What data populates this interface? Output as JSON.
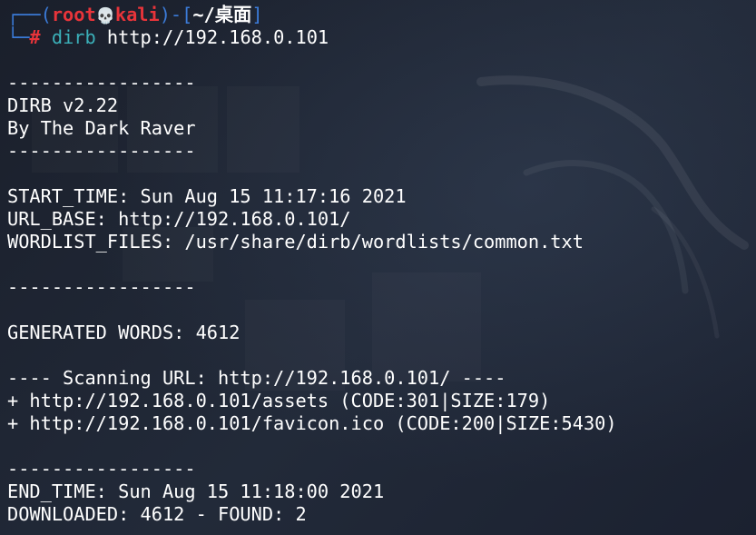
{
  "prompt": {
    "frame_top": "┌──(",
    "user": "root",
    "skull": "💀",
    "host": "kali",
    "mid": ")-[",
    "path": "~/桌面",
    "end": "]",
    "frame_bottom": "└─",
    "hash": "#",
    "command": "dirb",
    "argument": "http://192.168.0.101"
  },
  "output": [
    "",
    "-----------------",
    "DIRB v2.22",
    "By The Dark Raver",
    "-----------------",
    "",
    "START_TIME: Sun Aug 15 11:17:16 2021",
    "URL_BASE: http://192.168.0.101/",
    "WORDLIST_FILES: /usr/share/dirb/wordlists/common.txt",
    "",
    "-----------------",
    "",
    "GENERATED WORDS: 4612",
    "",
    "---- Scanning URL: http://192.168.0.101/ ----",
    "+ http://192.168.0.101/assets (CODE:301|SIZE:179)",
    "+ http://192.168.0.101/favicon.ico (CODE:200|SIZE:5430)",
    "",
    "-----------------",
    "END_TIME: Sun Aug 15 11:18:00 2021",
    "DOWNLOADED: 4612 - FOUND: 2"
  ],
  "colors": {
    "background": "#1d2330",
    "frame": "#3b7bd8",
    "accent_red": "#e8343a",
    "command": "#3bb0b9",
    "text": "#ffffff"
  }
}
